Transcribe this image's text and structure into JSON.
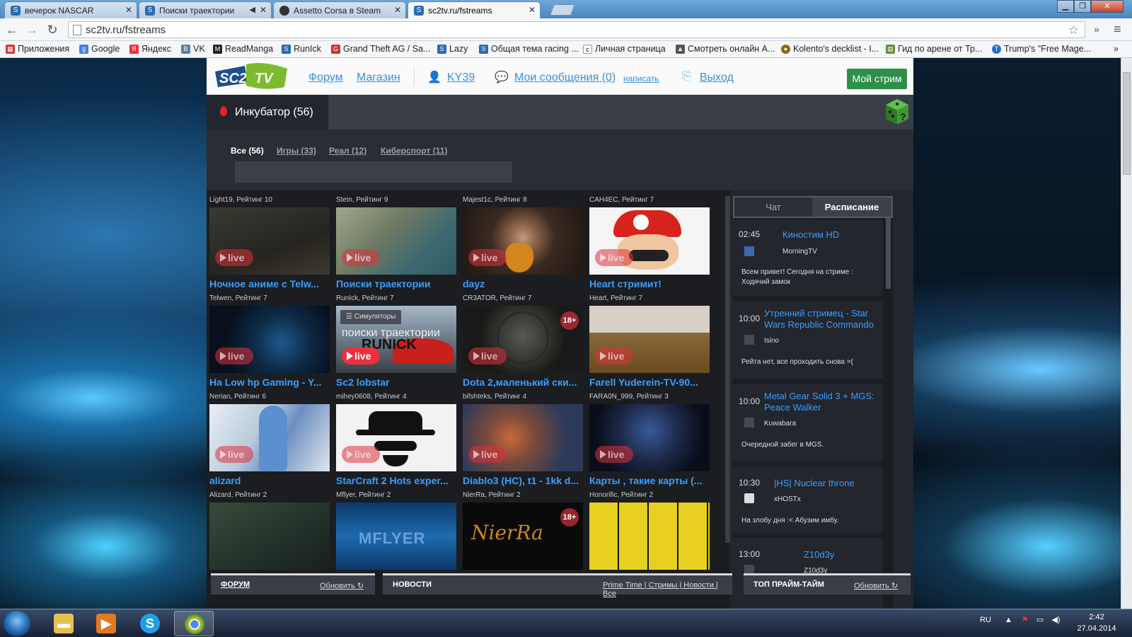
{
  "browser": {
    "tabs": [
      {
        "title": "вечерок NASCAR"
      },
      {
        "title": "Поиски траектории"
      },
      {
        "title": "Assetto Corsa в Steam"
      },
      {
        "title": "sc2tv.ru/fstreams"
      }
    ],
    "address": "sc2tv.ru/fstreams",
    "bookmarks": [
      "Приложения",
      "Google",
      "Яндекс",
      "VK",
      "ReadManga",
      "RunIck",
      "Grand Theft AG / Sa...",
      "Lazy",
      "Общая тема racing ...",
      "Личная страница",
      "Смотреть онлайн А...",
      "Kolento's decklist - I...",
      "Гид по арене от Тр...",
      "Trump's \"Free Mage..."
    ]
  },
  "site": {
    "nav": {
      "forum": "Форум",
      "shop": "Магазин",
      "user": "KY39",
      "messages": "Мои сообщения (0)",
      "write": "написать",
      "logout": "Выход",
      "my_stream": "Мой стрим"
    },
    "incubator": "Инкубатор (56)",
    "filters": [
      "Все (56)",
      "Игры (33)",
      "Реал (12)",
      "Киберспорт (11)"
    ],
    "streams": [
      {
        "top": "Light19, Рейтинг 10",
        "title": "Ночное аниме с Telw...",
        "bottom": "Telwen, Рейтинг 7",
        "live": "live"
      },
      {
        "top": "Stein, Рейтинг 9",
        "title": "Поиски траектории",
        "bottom": "RunIck, Рейтинг 7",
        "live": "live"
      },
      {
        "top": "Majest1c, Рейтинг 8",
        "title": "dayz",
        "bottom": "CR3ATOR, Рейтинг 7",
        "live": "live"
      },
      {
        "top": "CAH4EC, Рейтинг 7",
        "title": "Heart стримит!",
        "bottom": "Heart, Рейтинг 7",
        "live": "live"
      },
      {
        "title": "Ha Low hp Gaming - Y...",
        "bottom": "Nerian, Рейтинг 6",
        "live": "live"
      },
      {
        "title": "Sc2 lobstar",
        "bottom": "mihey0608, Рейтинг 4",
        "live": "live",
        "category": "Симуляторы",
        "overlay": "поиски траектории",
        "overlay2": "RUNICK"
      },
      {
        "title": "Dota 2,маленький ски...",
        "bottom": "bifshteks, Рейтинг 4",
        "live": "live",
        "age": "18+"
      },
      {
        "title": "Farell Yuderein-TV-90...",
        "bottom": "FARA0N_999, Рейтинг 3",
        "live": "live"
      },
      {
        "title": "alizard",
        "bottom": "Alizard, Рейтинг 2",
        "live": "live"
      },
      {
        "title": "StarCraft 2 Hots exper...",
        "bottom": "Mflyer, Рейтинг 2",
        "live": "live"
      },
      {
        "title": "Diablo3 (HC), t1 - 1kk d...",
        "bottom": "NierRa, Рейтинг 2",
        "live": "live"
      },
      {
        "title": "Карты , такие карты (...",
        "bottom": "Honorific, Рейтинг 2",
        "live": "live"
      },
      {
        "overlay": "MFLYER"
      },
      {
        "overlay": "NierRa",
        "age": "18+"
      }
    ],
    "schedule_tabs": {
      "chat": "Чат",
      "schedule": "Расписание"
    },
    "schedule": [
      {
        "time": "02:45",
        "title": "Киностим HD",
        "author": "MorningTV",
        "desc": "Всем привет! Сегодня на стриме : Ходячий замок"
      },
      {
        "time": "10:00",
        "title": "Утренний стримец - Star Wars Republic Commando",
        "author": "Isino",
        "desc": "Рейта нет, все проходить снова =("
      },
      {
        "time": "10:00",
        "title": "Metal Gear Solid 3 + MGS: Peace Walker",
        "author": "Kuwabara",
        "desc": "Очередной забег в MGS."
      },
      {
        "time": "10:30",
        "title": "|HS| Nuclear throne",
        "author": "xHOSTx",
        "desc": "На злобу дня :< Абузим имбу."
      },
      {
        "time": "13:00",
        "title": "Z10d3y",
        "author": "Z10d3y",
        "desc": ""
      }
    ],
    "footer": {
      "forum": "ФОРУМ",
      "forum_refresh": "Обновить",
      "news": "НОВОСТИ",
      "news_links": "Prime Time | Стримы | Новости | Все",
      "top": "ТОП ПРАЙМ-ТАЙМ",
      "top_refresh": "Обновить"
    }
  },
  "taskbar": {
    "lang": "RU",
    "time": "2:42",
    "date": "27.04.2014"
  }
}
